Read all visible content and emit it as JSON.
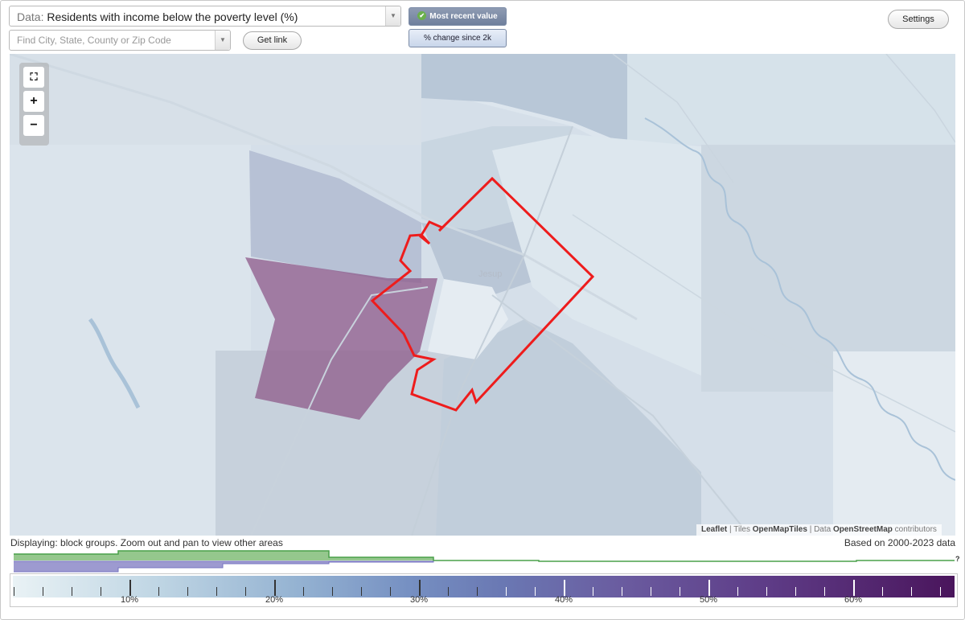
{
  "top": {
    "data_prefix": "Data:",
    "data_value": "Residents with income below the poverty level (%)",
    "find_placeholder": "Find City, State, County or Zip Code",
    "get_link": "Get link",
    "mode_recent": "Most recent value",
    "mode_change": "% change since 2k",
    "settings": "Settings"
  },
  "map": {
    "town_label": "Jesup",
    "attribution": {
      "leaflet": "Leaflet",
      "tiles_prefix": "Tiles",
      "tiles": "OpenMapTiles",
      "data_prefix": "Data",
      "data": "OpenStreetMap",
      "suffix": "contributors"
    },
    "colors": {
      "highlight_outline": "#ee1c1c",
      "high_value_fill": "#8e5a8a"
    }
  },
  "footer": {
    "displaying": "Displaying: block groups. Zoom out and pan to view other areas",
    "based_on": "Based on 2000-2023 data",
    "help": "?"
  },
  "legend": {
    "labels": [
      "10%",
      "20%",
      "30%",
      "40%",
      "50%",
      "60%"
    ],
    "min": 2,
    "max": 67
  }
}
